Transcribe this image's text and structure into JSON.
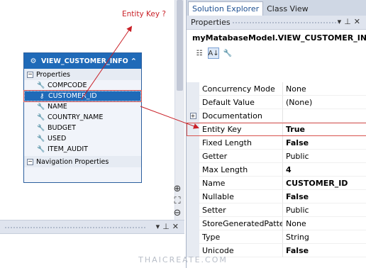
{
  "annotation": {
    "label": "Entity Key ?"
  },
  "entity": {
    "title": "VIEW_CUSTOMER_INFO",
    "properties_header": "Properties",
    "properties": [
      "COMPCODE",
      "CUSTOMER_ID",
      "NAME",
      "COUNTRY_NAME",
      "BUDGET",
      "USED",
      "ITEM_AUDIT"
    ],
    "selected_property": "CUSTOMER_ID",
    "navigation_header": "Navigation Properties"
  },
  "tabs": [
    "Solution Explorer",
    "Class View"
  ],
  "properties_panel": {
    "title": "Properties",
    "object_name": "myMatabaseModel.VIEW_CUSTOMER_INFO.C"
  },
  "grid": [
    {
      "name": "Concurrency Mode",
      "value": "None",
      "bold": false
    },
    {
      "name": "Default Value",
      "value": "(None)",
      "bold": false
    },
    {
      "name": "Documentation",
      "value": "",
      "bold": false,
      "expandable": true
    },
    {
      "name": "Entity Key",
      "value": "True",
      "bold": true,
      "highlight": true
    },
    {
      "name": "Fixed Length",
      "value": "False",
      "bold": true
    },
    {
      "name": "Getter",
      "value": "Public",
      "bold": false
    },
    {
      "name": "Max Length",
      "value": "4",
      "bold": true
    },
    {
      "name": "Name",
      "value": "CUSTOMER_ID",
      "bold": true
    },
    {
      "name": "Nullable",
      "value": "False",
      "bold": true
    },
    {
      "name": "Setter",
      "value": "Public",
      "bold": false
    },
    {
      "name": "StoreGeneratedPattern",
      "value": "None",
      "bold": false
    },
    {
      "name": "Type",
      "value": "String",
      "bold": false
    },
    {
      "name": "Unicode",
      "value": "False",
      "bold": true
    }
  ],
  "watermark": "THAICREATE.COM",
  "colors": {
    "accent": "#1f6ab8",
    "annotation": "#c91f26"
  }
}
